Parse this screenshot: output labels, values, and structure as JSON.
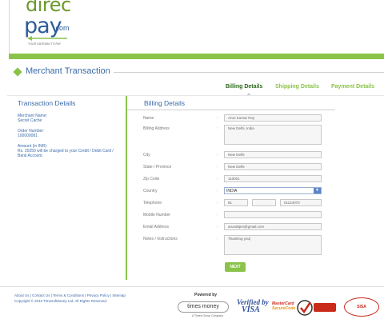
{
  "header": {
    "logo_direc": "direc",
    "logo_pay": "pay",
    "logo_com": ".com",
    "logo_tagline": "YOUR GATEWAY TO PAY"
  },
  "section": {
    "title": "Merchant Transaction"
  },
  "tabs": [
    {
      "label": "Billing Details",
      "active": true
    },
    {
      "label": "Shipping Details",
      "active": false
    },
    {
      "label": "Payment Details",
      "active": false
    }
  ],
  "transaction": {
    "title": "Transaction Details",
    "merchant_label": "Merchant Name:",
    "merchant_value": "Secret Cache",
    "order_label": "Order Number:",
    "order_value": "100000081",
    "amount_label": "Amount (in INR):",
    "amount_text": "Rs. 20250 will be charged to your Credit / Debit Card / Bank Account."
  },
  "billing": {
    "title": "Billing Details",
    "labels": {
      "name": "Name",
      "address": "Billing Address",
      "city": "City",
      "state": "State / Province",
      "zip": "Zip Code",
      "country": "Country",
      "telephone": "Telephone",
      "mobile": "Mobile Number",
      "email": "Email Address",
      "notes": "Notes / Instructions"
    },
    "values": {
      "name": "Arun Kumar Roy",
      "address": "New Delhi, India",
      "city": "New Delhi",
      "state": "New Delhi",
      "zip": "110001",
      "country": "INDIA",
      "phone_code": "91",
      "phone_area": "",
      "phone_number": "01124070",
      "mobile": "",
      "email": "arunaltpm@gmail.com",
      "notes": "Thanking you|"
    },
    "next_label": "NEXT"
  },
  "footer": {
    "links": "About Us | Contact Us | Terms & Conditions | Privacy Policy | Sitemap",
    "copyright": "Copyright © 2010 TimesofMoney Ltd. All Rights Reserved.",
    "powered_by": "Powered by",
    "times_money": "times money",
    "times_money_sub": "A Times Group Company",
    "verified_line1": "Verified by",
    "verified_line2": "VISA",
    "mastercard": "MasterCard",
    "securecode": "SecureCode",
    "verisign": "VeriSign Trusted",
    "sisa": "SISA"
  },
  "colors": {
    "brand_green": "#8bc34a",
    "brand_blue": "#3b6aa8"
  }
}
